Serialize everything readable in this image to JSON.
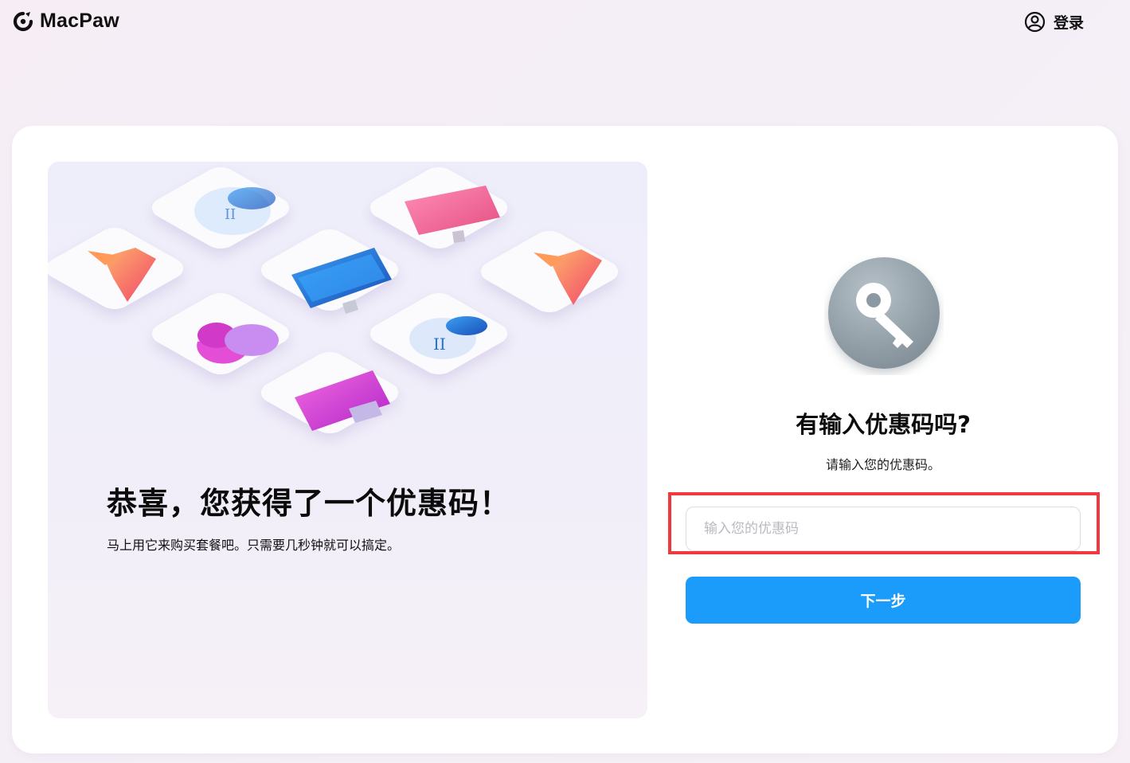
{
  "brand": {
    "name": "MacPaw"
  },
  "header": {
    "login_label": "登录"
  },
  "promo": {
    "title": "恭喜，您获得了一个优惠码！",
    "subtitle": "马上用它来购买套餐吧。只需要几秒钟就可以搞定。"
  },
  "form": {
    "title": "有输入优惠码吗?",
    "subtitle": "请输入您的优惠码。",
    "input_placeholder": "输入您的优惠码",
    "input_value": "",
    "next_label": "下一步"
  },
  "colors": {
    "accent": "#1b9cfb",
    "highlight": "#ee3a3f",
    "key_badge": "#8e9aa3"
  },
  "icons": [
    "macpaw-logo-icon",
    "user-circle-icon",
    "key-icon"
  ]
}
